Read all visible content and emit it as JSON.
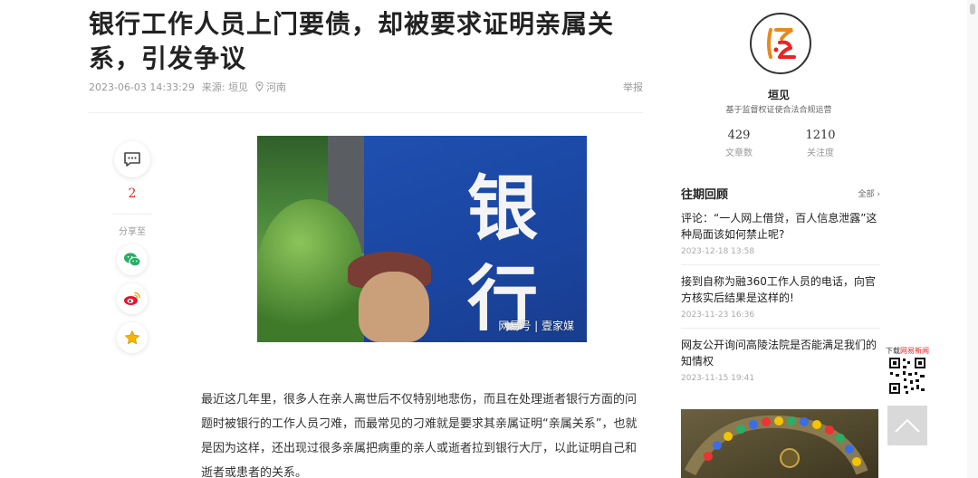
{
  "article": {
    "title": "银行工作人员上门要债，却被要求证明亲属关系，引发争议",
    "date": "2023-06-03 14:33:29",
    "source": "来源: 垣见",
    "location": "河南",
    "report": "举报",
    "image_watermark": "网易号 | 壹家媒",
    "image_chars": [
      "银",
      "行"
    ],
    "body": "最近这几年里，很多人在亲人离世后不仅特别地悲伤，而且在处理逝者银行方面的问题时被银行的工作人员刁难，而最常见的刁难就是要求其亲属证明“亲属关系”，也就是因为这样，还出现过很多亲属把病重的亲人或逝者拉到银行大厅，以此证明自己和逝者或患者的关系。"
  },
  "side": {
    "comment_count": "2",
    "share_label": "分享至",
    "share_icons": [
      "wechat-icon",
      "weibo-icon",
      "favorite-icon"
    ]
  },
  "author": {
    "name": "垣见",
    "description": "基于监督权证使合法合规运营",
    "stats": [
      {
        "num": "429",
        "label": "文章数"
      },
      {
        "num": "1210",
        "label": "关注度"
      }
    ]
  },
  "past": {
    "title": "往期回顾",
    "all_label": "全部",
    "items": [
      {
        "title": "评论：“一人网上借贷，百人信息泄露”这种局面该如何禁止呢?",
        "date": "2023-12-18 13:58"
      },
      {
        "title": "接到自称为融360工作人员的电话，向官方核实后结果是这样的!",
        "date": "2023-11-23 16:36"
      },
      {
        "title": "网友公开询问高陵法院是否能满足我们的知情权",
        "date": "2023-11-15 19:41"
      }
    ]
  },
  "download": {
    "prefix": "下载",
    "highlight": "网易新闻"
  },
  "colors": {
    "accent": "#ee2222",
    "bank_blue": "#1f4fb0",
    "wechat": "#2aae67",
    "weibo": "#e6162d",
    "favorite": "#f5b400"
  }
}
